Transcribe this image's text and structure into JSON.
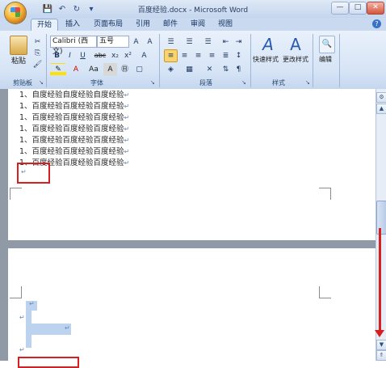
{
  "window": {
    "title": "百度经验.docx - Microsoft Word",
    "minimize": "—",
    "maximize": "□",
    "close": "✕"
  },
  "qat": {
    "save": "💾",
    "undo": "↶",
    "redo": "↻",
    "more": "▾"
  },
  "tabs": [
    "开始",
    "插入",
    "页面布局",
    "引用",
    "邮件",
    "审阅",
    "视图"
  ],
  "help": "?",
  "ribbon": {
    "clipboard": {
      "label": "剪贴板",
      "paste": "粘贴"
    },
    "font": {
      "label": "字体",
      "name": "Calibri (西文)",
      "size": "五号",
      "bold": "B",
      "italic": "I",
      "underline": "U",
      "strike": "abc",
      "sub": "x₂",
      "sup": "x²",
      "change_case": "Aa",
      "font_color": "A",
      "char_shading": "A",
      "enclose": "㊐",
      "clear": "A"
    },
    "paragraph": {
      "label": "段落"
    },
    "styles": {
      "label": "样式",
      "quick": "快速样式",
      "change": "更改样式"
    },
    "editing": {
      "label": "编辑"
    }
  },
  "document": {
    "lines": [
      "1、自度经验自度经验自度经验",
      "1、百度经验百度经验百度经验",
      "1、百度经验百度经验百度经验",
      "1、百度经验百度经验百度经验",
      "1、百度经验百度经验百度经验",
      "1、百度经验百度经验百度经验",
      "1、百度经验百度经验百度经验"
    ],
    "para_mark": "↵"
  },
  "colors": {
    "accent_red": "#d62020",
    "ribbon_blue": "#d6e4f6"
  }
}
